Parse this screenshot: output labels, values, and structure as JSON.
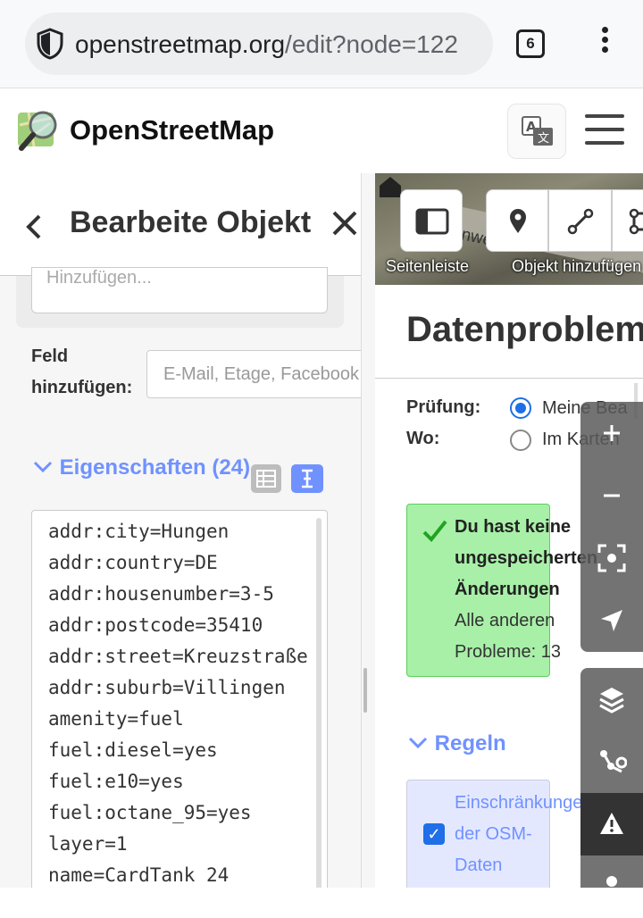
{
  "browser": {
    "url_host": "openstreetmap.org",
    "url_path": "/edit?node=122",
    "tab_count": "6",
    "shield_icon": "shield-icon",
    "menu_icon": "kebab-menu-icon"
  },
  "site": {
    "name": "OpenStreetMap",
    "logo_icon": "magnifier-map-logo",
    "translate_icon": "translate-icon",
    "menu_icon": "hamburger-icon"
  },
  "sidebar": {
    "title": "Bearbeite Objekt",
    "prev_input_placeholder": "Hinzufügen...",
    "add_field_label_line1": "Feld",
    "add_field_label_line2": "hinzufügen:",
    "add_field_placeholder": "E-Mail, Etage, Facebook",
    "properties_label": "Eigenschaften (24)",
    "tags": [
      "addr:city=Hungen",
      "addr:country=DE",
      "addr:housenumber=3-5",
      "addr:postcode=35410",
      "addr:street=Kreuzstraße",
      "addr:suburb=Villingen",
      "amenity=fuel",
      "fuel:diesel=yes",
      "fuel:e10=yes",
      "fuel:octane_95=yes",
      "layer=1",
      "name=CardTank 24"
    ]
  },
  "map": {
    "road_label": "rnweg",
    "sidebar_button_label": "Seitenleiste",
    "add_object_label": "Objekt hinzufügen"
  },
  "issues": {
    "title": "Datenproblem",
    "check_label": "Prüfung:",
    "where_label": "Wo:",
    "option_my_edits": "Meine Bea",
    "option_in_map": "Im Karten",
    "ok_title": "Du hast keine ungespeicherten Änderungen",
    "ok_subtitle": "Alle anderen Probleme: 13",
    "rules_label": "Regeln",
    "rule_text": "Einschränkungen der OSM-Daten"
  },
  "colors": {
    "accent": "#7092ff",
    "radio_blue": "#1e6fe8",
    "ok_green": "#a8f0a8",
    "control_gray": "#5a5a5a"
  }
}
